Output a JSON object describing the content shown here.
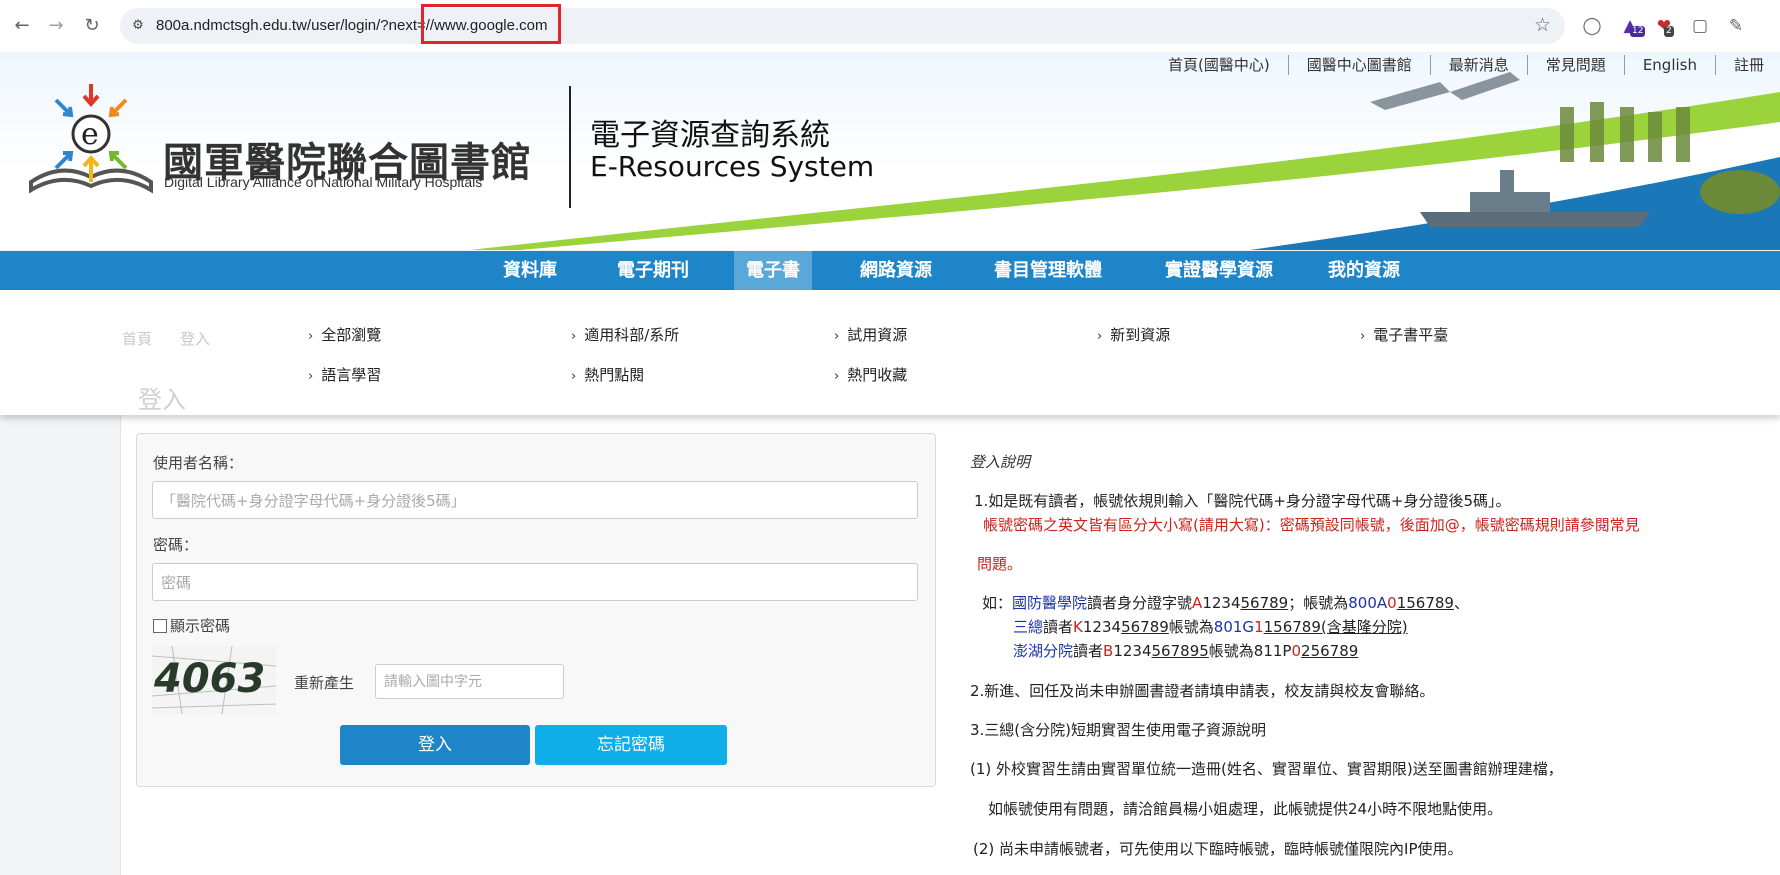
{
  "browser": {
    "url": "800a.ndmctsgh.edu.tw/user/login/?next=//www.google.com",
    "ext_badge_1": "12",
    "ext_badge_2": "2"
  },
  "topnav": [
    "首頁(國醫中心)",
    "國醫中心圖書館",
    "最新消息",
    "常見問題",
    "English",
    "註冊"
  ],
  "logo": {
    "title": "國軍醫院聯合圖書館",
    "subtitle": "Digital Library Alliance of National Military Hospitals"
  },
  "system": {
    "title": "電子資源查詢系統",
    "subtitle": "E-Resources System"
  },
  "mainnav": {
    "tabs": [
      "資料庫",
      "電子期刊",
      "電子書",
      "網路資源",
      "書目管理軟體",
      "實證醫學資源",
      "我的資源"
    ],
    "active_index": 2
  },
  "dropdown": {
    "items": [
      "全部瀏覽",
      "適用科部/系所",
      "試用資源",
      "新到資源",
      "電子書平臺",
      "語言學習",
      "熱門點閱",
      "熱門收藏"
    ]
  },
  "behind": {
    "breadcrumb_home": "首頁",
    "breadcrumb_login": "登入",
    "page_title": "登入"
  },
  "login": {
    "username_label": "使用者名稱：",
    "username_placeholder": "「醫院代碼+身分證字母代碼+身分證後5碼」",
    "password_label": "密碼：",
    "password_placeholder": "密碼",
    "show_password": "顯示密碼",
    "captcha_text": "4063",
    "regen_label": "重新產生",
    "captcha_placeholder": "請輸入圖中字元",
    "login_button": "登入",
    "forgot_button": "忘記密碼"
  },
  "info": {
    "heading": "登入說明",
    "line1": "1.如是既有讀者，帳號依規則輸入「醫院代碼+身分證字母代碼+身分證後5碼」。",
    "line2": "帳號密碼之英文皆有區分大小寫(請用大寫)：密碼預設同帳號，後面加@，帳號密碼規則請參閱常見",
    "line3": "問題。",
    "ex_prefix": "如：",
    "ex1_org": "國防醫學院",
    "ex1_mid": "讀者身分證字號",
    "ex1_id_red": "A",
    "ex1_id_a": "1234",
    "ex1_id_u": "56789",
    "ex1_sep": "；帳號為",
    "ex1_acc_b": "800A",
    "ex1_acc_r": "0",
    "ex1_acc_u1": "1",
    "ex1_acc_u2": "56789",
    "ex1_end": "、",
    "ex2_org": "三總",
    "ex2_mid": "讀者",
    "ex2_id_red": "K",
    "ex2_id_a": "1234",
    "ex2_id_u": "56789",
    "ex2_sep": "帳號為",
    "ex2_acc_b": "801G",
    "ex2_acc_r": "1",
    "ex2_acc_u1": "1",
    "ex2_acc_u2": "56789(含基隆分院)",
    "ex3_org": "澎湖分院",
    "ex3_mid": "讀者",
    "ex3_id_red": "B",
    "ex3_id_a": "1234",
    "ex3_id_u": "567895",
    "ex3_sep": "帳號為",
    "ex3_acc_b": "811P",
    "ex3_acc_r": "0",
    "ex3_acc_u": "256789",
    "line4": "2.新進、回任及尚未申辦圖書證者請填申請表，校友請與校友會聯絡。",
    "line5": "3.三總(含分院)短期實習生使用電子資源說明",
    "line6": "(1) 外校實習生請由實習單位統一造冊(姓名、實習單位、實習期限)送至圖書館辦理建檔，",
    "line7": "如帳號使用有問題，請洽館員楊小姐處理，此帳號提供24小時不限地點使用。",
    "line8": "(2) 尚未申請帳號者，可先使用以下臨時帳號，臨時帳號僅限院內IP使用。"
  },
  "colors": {
    "nav_blue": "#1d85c8",
    "active_tab": "#5aa7d9",
    "login_btn": "#1d85c8",
    "forgot_btn": "#10aee8",
    "red_text": "#d0201a",
    "blue_text": "#1a34a8"
  }
}
